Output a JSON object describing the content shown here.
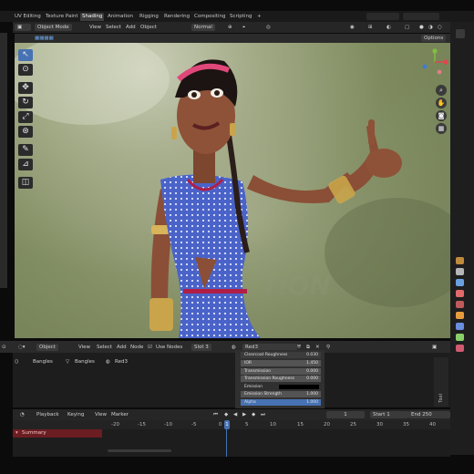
{
  "workspace_tabs": [
    "UV Editing",
    "Texture Paint",
    "Shading",
    "Animation",
    "Rigging",
    "Rendering",
    "Compositing",
    "Scripting"
  ],
  "plus": "+",
  "viewport_header": {
    "mode": "Object Mode",
    "view": "View",
    "select": "Select",
    "add": "Add",
    "object": "Object",
    "shading": "Normal",
    "options": "Options"
  },
  "watermark": "TION",
  "node_header": {
    "editor": "Object",
    "view": "View",
    "select": "Select",
    "add": "Add",
    "node": "Node",
    "use_nodes": "Use Nodes",
    "slot": "Slot 3",
    "material": "Red3"
  },
  "breadcrumb": [
    "Bangles",
    "Bangles",
    "Red3"
  ],
  "material_rows": [
    {
      "label": "Clearcoat Roughness",
      "value": "0.030"
    },
    {
      "label": "IOR",
      "value": "1.450"
    },
    {
      "label": "Transmission",
      "value": "0.000"
    },
    {
      "label": "Transmission Roughness",
      "value": "0.000"
    },
    {
      "label": "Emission",
      "value": ""
    },
    {
      "label": "Emission Strength",
      "value": "1.000"
    },
    {
      "label": "Alpha",
      "value": "1.000"
    }
  ],
  "side_tab": "Tool",
  "timeline": {
    "playback": "Playback",
    "keying": "Keying",
    "view": "View",
    "marker": "Marker",
    "current": "1",
    "start_label": "Start",
    "start": "1",
    "end_label": "End",
    "end": "250",
    "summary": "Summary",
    "ticks": [
      "-20",
      "-15",
      "-10",
      "-5",
      "0",
      "5",
      "10",
      "15",
      "20",
      "25",
      "30",
      "35",
      "40"
    ],
    "playhead": "1"
  },
  "colors": {
    "accent": "#4772b3",
    "dress": "#4a63c8"
  }
}
